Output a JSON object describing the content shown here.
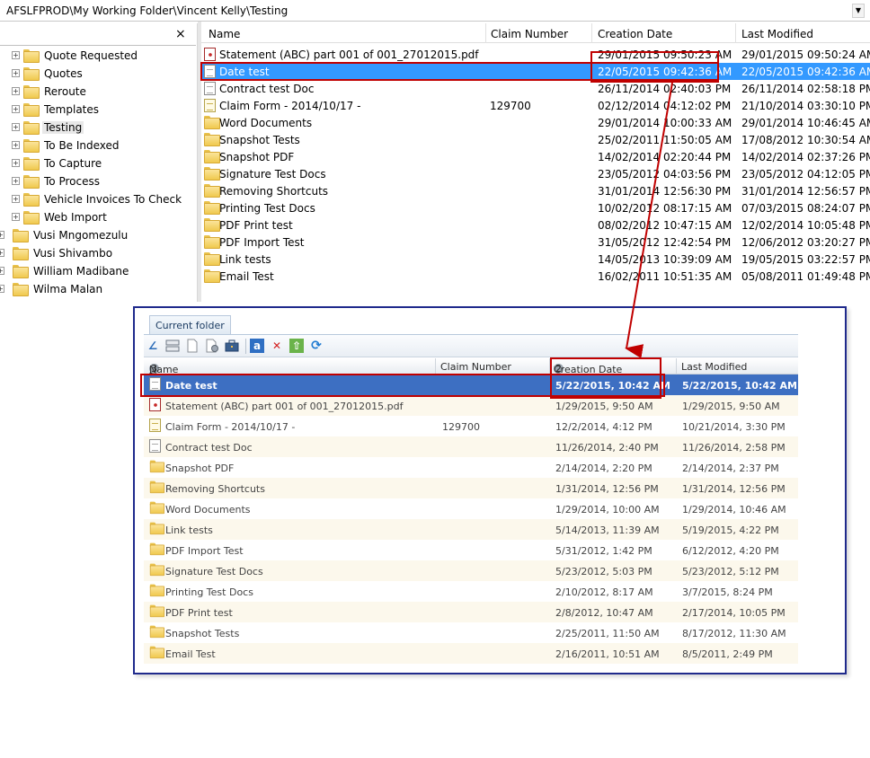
{
  "address": {
    "path": "AFSLFPROD\\My Working Folder\\Vincent Kelly\\Testing"
  },
  "tree": {
    "close_label": "×",
    "items": [
      {
        "label": "Quote Requested",
        "expander": "+"
      },
      {
        "label": "Quotes",
        "expander": "+"
      },
      {
        "label": "Reroute",
        "expander": "+"
      },
      {
        "label": "Templates",
        "expander": "+"
      },
      {
        "label": "Testing",
        "expander": "+",
        "selected": true
      },
      {
        "label": "To Be Indexed",
        "expander": "+"
      },
      {
        "label": "To Capture",
        "expander": "+"
      },
      {
        "label": "To Process",
        "expander": "+"
      },
      {
        "label": "Vehicle Invoices To Check",
        "expander": "+"
      },
      {
        "label": "Web Import",
        "expander": "+"
      },
      {
        "label": "Vusi Mngomezulu",
        "expander": "+"
      },
      {
        "label": "Vusi Shivambo",
        "expander": "+"
      },
      {
        "label": "William Madibane",
        "expander": "+"
      },
      {
        "label": "Wilma Malan",
        "expander": "+"
      }
    ]
  },
  "list": {
    "columns": {
      "name": "Name",
      "claim": "Claim Number",
      "created": "Creation Date",
      "modified": "Last Modified"
    },
    "rows": [
      {
        "icon": "pdf-icon",
        "name": "Statement (ABC) part 001 of 001_27012015.pdf",
        "claim": "",
        "created": "29/01/2015 09:50:23 AM",
        "modified": "29/01/2015 09:50:24 AM"
      },
      {
        "icon": "document-icon",
        "name": "Date test",
        "claim": "",
        "created": "22/05/2015 09:42:36 AM",
        "modified": "22/05/2015 09:42:36 AM",
        "selected": true
      },
      {
        "icon": "document-icon",
        "name": "Contract test Doc",
        "claim": "",
        "created": "26/11/2014 02:40:03 PM",
        "modified": "26/11/2014 02:58:18 PM"
      },
      {
        "icon": "claim-form-icon",
        "name": "Claim Form - 2014/10/17 -",
        "claim": "129700",
        "created": "02/12/2014 04:12:02 PM",
        "modified": "21/10/2014 03:30:10 PM"
      },
      {
        "icon": "folder-icon",
        "name": "Word Documents",
        "claim": "",
        "created": "29/01/2014 10:00:33 AM",
        "modified": "29/01/2014 10:46:45 AM"
      },
      {
        "icon": "folder-icon",
        "name": "Snapshot Tests",
        "claim": "",
        "created": "25/02/2011 11:50:05 AM",
        "modified": "17/08/2012 10:30:54 AM"
      },
      {
        "icon": "folder-icon",
        "name": "Snapshot PDF",
        "claim": "",
        "created": "14/02/2014 02:20:44 PM",
        "modified": "14/02/2014 02:37:26 PM"
      },
      {
        "icon": "folder-icon",
        "name": "Signature Test Docs",
        "claim": "",
        "created": "23/05/2012 04:03:56 PM",
        "modified": "23/05/2012 04:12:05 PM"
      },
      {
        "icon": "folder-icon",
        "name": "Removing Shortcuts",
        "claim": "",
        "created": "31/01/2014 12:56:30 PM",
        "modified": "31/01/2014 12:56:57 PM"
      },
      {
        "icon": "folder-icon",
        "name": "Printing Test Docs",
        "claim": "",
        "created": "10/02/2012 08:17:15 AM",
        "modified": "07/03/2015 08:24:07 PM"
      },
      {
        "icon": "folder-icon",
        "name": "PDF Print test",
        "claim": "",
        "created": "08/02/2012 10:47:15 AM",
        "modified": "12/02/2014 10:05:48 PM"
      },
      {
        "icon": "folder-icon",
        "name": "PDF Import Test",
        "claim": "",
        "created": "31/05/2012 12:42:54 PM",
        "modified": "12/06/2012 03:20:27 PM"
      },
      {
        "icon": "folder-icon",
        "name": "Link tests",
        "claim": "",
        "created": "14/05/2013 10:39:09 AM",
        "modified": "19/05/2015 03:22:57 PM"
      },
      {
        "icon": "folder-icon",
        "name": "Email Test",
        "claim": "",
        "created": "16/02/2011 10:51:35 AM",
        "modified": "05/08/2011 01:49:48 PM"
      }
    ]
  },
  "inset": {
    "tab_label": "Current folder",
    "toolbar_icons": [
      "edit-icon",
      "split-icon",
      "new-document-icon",
      "document-properties-icon",
      "briefcase-icon",
      "rename-icon",
      "delete-icon",
      "upload-icon",
      "refresh-icon"
    ],
    "toolbar_glyphs": {
      "edit": "∠",
      "delete": "✕",
      "refresh": "⟳",
      "upload": "⇧",
      "rename": "a"
    },
    "columns": {
      "name": "Name",
      "name_badge": "3",
      "claim": "Claim Number",
      "created": "Creation Date",
      "created_badge": "2",
      "modified": "Last Modified"
    },
    "rows": [
      {
        "icon": "document-icon",
        "name": "Date test",
        "claim": "",
        "created": "5/22/2015, 10:42 AM",
        "modified": "5/22/2015, 10:42 AM",
        "selected": true
      },
      {
        "icon": "pdf-icon",
        "name": "Statement (ABC) part 001 of 001_27012015.pdf",
        "claim": "",
        "created": "1/29/2015, 9:50 AM",
        "modified": "1/29/2015, 9:50 AM"
      },
      {
        "icon": "claim-form-icon",
        "name": "Claim Form - 2014/10/17 -",
        "claim": "129700",
        "created": "12/2/2014, 4:12 PM",
        "modified": "10/21/2014, 3:30 PM"
      },
      {
        "icon": "document-icon",
        "name": "Contract test Doc",
        "claim": "",
        "created": "11/26/2014, 2:40 PM",
        "modified": "11/26/2014, 2:58 PM"
      },
      {
        "icon": "folder-icon",
        "name": "Snapshot PDF",
        "claim": "",
        "created": "2/14/2014, 2:20 PM",
        "modified": "2/14/2014, 2:37 PM"
      },
      {
        "icon": "folder-icon",
        "name": "Removing Shortcuts",
        "claim": "",
        "created": "1/31/2014, 12:56 PM",
        "modified": "1/31/2014, 12:56 PM"
      },
      {
        "icon": "folder-icon",
        "name": "Word Documents",
        "claim": "",
        "created": "1/29/2014, 10:00 AM",
        "modified": "1/29/2014, 10:46 AM"
      },
      {
        "icon": "folder-icon",
        "name": "Link tests",
        "claim": "",
        "created": "5/14/2013, 11:39 AM",
        "modified": "5/19/2015, 4:22 PM"
      },
      {
        "icon": "folder-icon",
        "name": "PDF Import Test",
        "claim": "",
        "created": "5/31/2012, 1:42 PM",
        "modified": "6/12/2012, 4:20 PM"
      },
      {
        "icon": "folder-icon",
        "name": "Signature Test Docs",
        "claim": "",
        "created": "5/23/2012, 5:03 PM",
        "modified": "5/23/2012, 5:12 PM"
      },
      {
        "icon": "folder-icon",
        "name": "Printing Test Docs",
        "claim": "",
        "created": "2/10/2012, 8:17 AM",
        "modified": "3/7/2015, 8:24 PM"
      },
      {
        "icon": "folder-icon",
        "name": "PDF Print test",
        "claim": "",
        "created": "2/8/2012, 10:47 AM",
        "modified": "2/17/2014, 10:05 PM"
      },
      {
        "icon": "folder-icon",
        "name": "Snapshot Tests",
        "claim": "",
        "created": "2/25/2011, 11:50 AM",
        "modified": "8/17/2012, 11:30 AM"
      },
      {
        "icon": "folder-icon",
        "name": "Email Test",
        "claim": "",
        "created": "2/16/2011, 10:51 AM",
        "modified": "8/5/2011, 2:49 PM"
      }
    ]
  },
  "colors": {
    "selection_top": "#3399ff",
    "selection_inset": "#3d6fc2",
    "highlight": "#c00000",
    "inset_border": "#1f2a8c"
  }
}
